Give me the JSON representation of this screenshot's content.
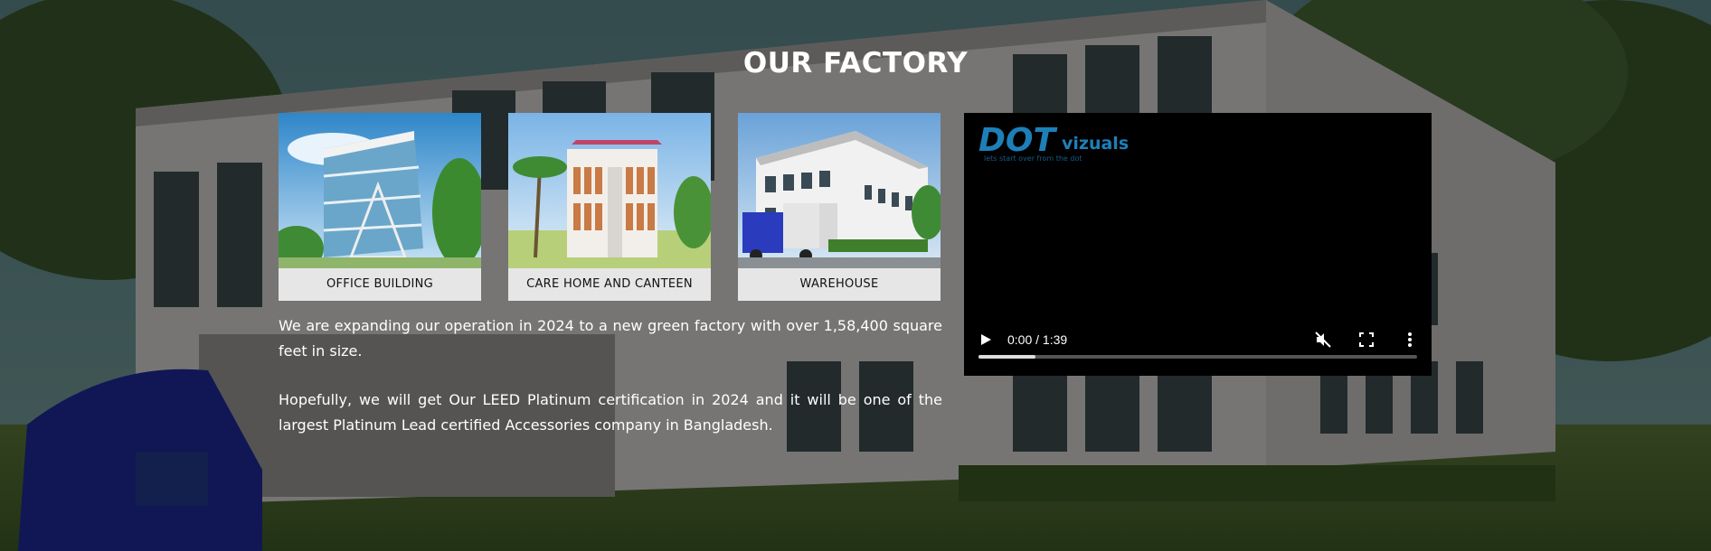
{
  "section": {
    "title": "OUR FACTORY"
  },
  "cards": [
    {
      "label": "OFFICE BUILDING",
      "image": "office-building-photo"
    },
    {
      "label": "CARE HOME AND CANTEEN",
      "image": "canteen-building-photo"
    },
    {
      "label": "WAREHOUSE",
      "image": "warehouse-photo"
    }
  ],
  "paragraphs": [
    "We are expanding our operation  in 2024 to a new green factory with over  1,58,400 square feet in size.",
    "Hopefully, we will get Our LEED Platinum certification in 2024 and it will be one of the largest Platinum Lead certified Accessories company in Bangladesh."
  ],
  "video": {
    "logo_main": "DOT",
    "logo_sub": "vizuals",
    "logo_tagline": "lets start over from the dot",
    "time": "0:00 / 1:39",
    "progress_fraction": 0.13,
    "icons": {
      "play": "play-icon",
      "mute": "muted-speaker-icon",
      "fullscreen": "fullscreen-icon",
      "more": "more-vertical-icon"
    }
  },
  "colors": {
    "overlay": "#000000",
    "title": "#ffffff",
    "card_label_bg": "#e6e6e6",
    "logo_blue": "#1e7fb8"
  }
}
